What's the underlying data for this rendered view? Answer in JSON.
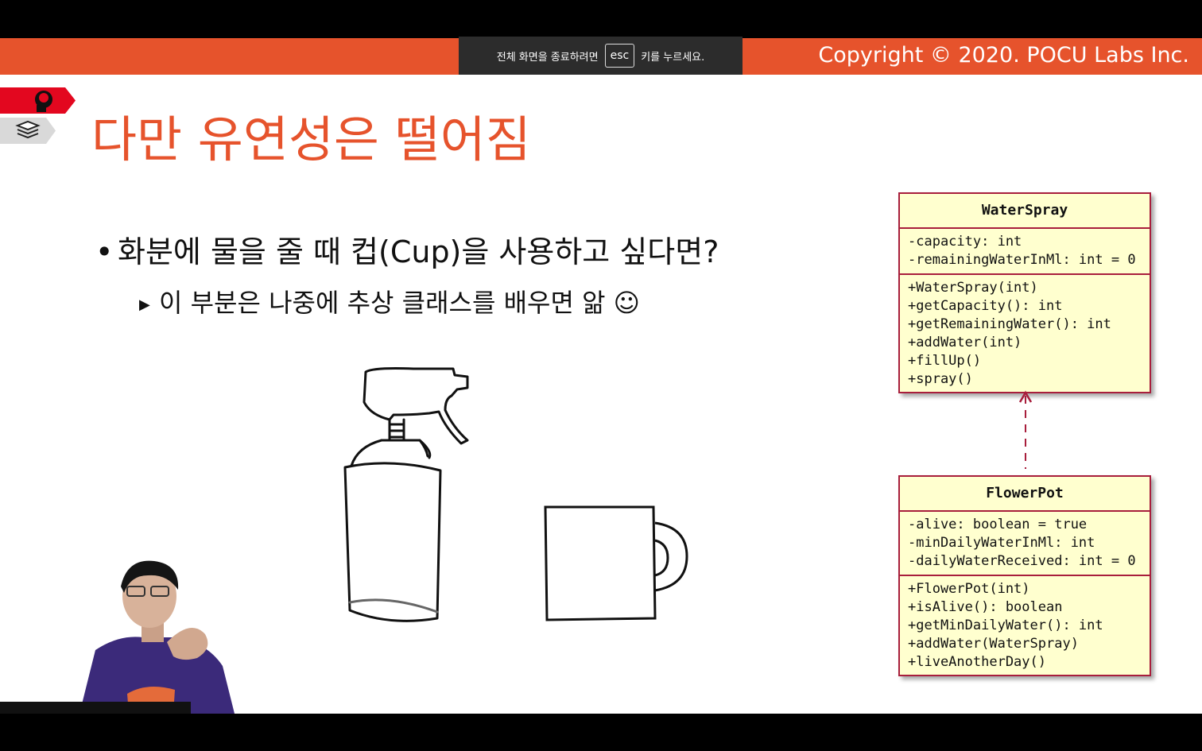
{
  "fullscreen_notice": {
    "before": "전체 화면을 종료하려면",
    "key": "esc",
    "after": "키를 누르세요."
  },
  "header": {
    "copyright": "Copyright © 2020. POCU Labs Inc."
  },
  "slide": {
    "title": "다만 유연성은 떨어짐",
    "bullets": [
      {
        "text": "화분에 물을 줄 때 컵(Cup)을 사용하고 싶다면?"
      },
      {
        "text": "이 부분은 나중에 추상 클래스를 배우면 앎 ☺"
      }
    ]
  },
  "icons": {
    "brain": "brain-head-icon",
    "books": "book-stack-icon",
    "bullet_arrow": "triangle-right-icon"
  },
  "colors": {
    "accent": "#e6532c",
    "uml_border": "#a81e3c",
    "uml_fill": "#ffffcf"
  },
  "uml": {
    "water_spray": {
      "name": "WaterSpray",
      "attributes": [
        "-capacity: int",
        "-remainingWaterInMl: int = 0"
      ],
      "methods": [
        "+WaterSpray(int)",
        "+getCapacity(): int",
        "+getRemainingWater(): int",
        "+addWater(int)",
        "+fillUp()",
        "+spray()"
      ]
    },
    "flower_pot": {
      "name": "FlowerPot",
      "attributes": [
        "-alive: boolean = true",
        "-minDailyWaterInMl: int",
        "-dailyWaterReceived: int = 0"
      ],
      "methods": [
        "+FlowerPot(int)",
        "+isAlive(): boolean",
        "+getMinDailyWater(): int",
        "+addWater(WaterSpray)",
        "+liveAnotherDay()"
      ]
    }
  }
}
